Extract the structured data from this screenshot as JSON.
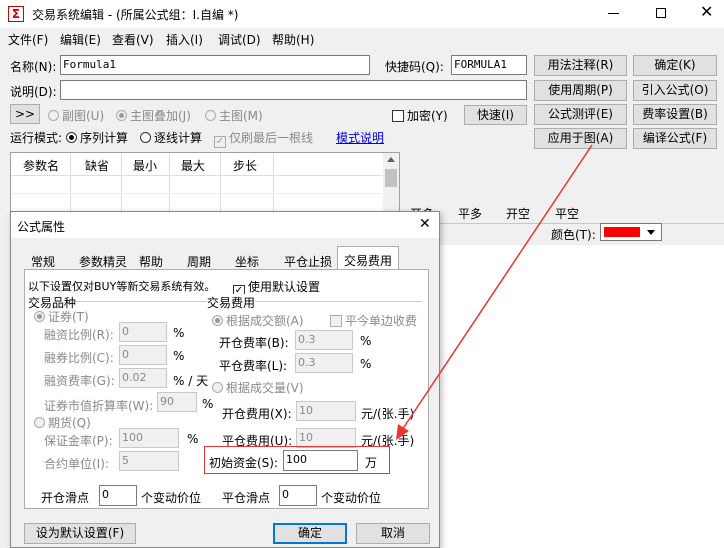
{
  "window": {
    "title": "交易系统编辑 - (所属公式组：I.自编 *)",
    "icon_char": "Σ"
  },
  "menu": [
    "文件(F)",
    "编辑(E)",
    "查看(V)",
    "插入(I)",
    "调试(D)",
    "帮助(H)"
  ],
  "form": {
    "name_label": "名称(N):",
    "name_value": "Formula1",
    "shortcode_label": "快捷码(Q):",
    "shortcode_value": "FORMULA1",
    "desc_label": "说明(D):",
    "desc_value": "",
    "expand": ">>",
    "radio_subchart": "副图(U)",
    "radio_overlay": "主图叠加(J)",
    "radio_main": "主图(M)",
    "encrypt": "加密(Y)",
    "quick": "快速(I)",
    "run_mode_label": "运行模式:",
    "run_seq": "序列计算",
    "run_step": "逐线计算",
    "refresh_last": "仅刷最后一根线",
    "mode_help": "模式说明"
  },
  "right_buttons": [
    "用法注释(R)",
    "确定(K)",
    "使用周期(P)",
    "引入公式(O)",
    "公式测评(E)",
    "费率设置(B)",
    "应用于图(A)",
    "编译公式(F)"
  ],
  "param_table": {
    "headers": [
      "参数名",
      "缺省",
      "最小",
      "最大",
      "步长"
    ]
  },
  "signal_tabs": [
    "开多",
    "平多",
    "开空",
    "平空"
  ],
  "color_label": "颜色(T):",
  "accent_color": "#ff0000",
  "dialog": {
    "title": "公式属性",
    "tabs": [
      "常规",
      "参数精灵",
      "帮助",
      "周期",
      "坐标",
      "平仓止损",
      "交易费用"
    ],
    "active_tab": "交易费用",
    "note": "以下设置仅对BUY等新交易系统有效。",
    "use_default": "使用默认设置",
    "group_variety": "交易品种",
    "securities": "证券(T)",
    "margin_ratio_label": "融资比例(R):",
    "margin_ratio": "0",
    "short_ratio_label": "融券比例(C):",
    "short_ratio": "0",
    "financing_rate_label": "融资费率(G):",
    "financing_rate": "0.02",
    "per_day": "% / 天",
    "discount_label": "证券市值折算率(W):",
    "discount": "90",
    "futures": "期货(Q)",
    "deposit_label": "保证金率(P):",
    "deposit": "100",
    "contract_unit_label": "合约单位(I):",
    "contract_unit": "5",
    "percent": "%",
    "group_fee": "交易费用",
    "by_amount": "根据成交额(A)",
    "net_close": "平今单边收费",
    "open_rate_label": "开仓费率(B):",
    "open_rate": "0.3",
    "close_rate_label": "平仓费率(L):",
    "close_rate": "0.3",
    "by_volume": "根据成交量(V)",
    "open_fee_label": "开仓费用(X):",
    "open_fee": "10",
    "close_fee_label": "平仓费用(U):",
    "close_fee": "10",
    "per_lot": "元/(张.手)",
    "init_capital_label": "初始资金(S):",
    "init_capital": "100",
    "wan": "万",
    "open_slip_label": "开仓滑点",
    "open_slip": "0",
    "close_slip_label": "平仓滑点",
    "close_slip": "0",
    "tick_unit": "个变动价位",
    "set_default": "设为默认设置(F)",
    "ok": "确定",
    "cancel": "取消"
  }
}
